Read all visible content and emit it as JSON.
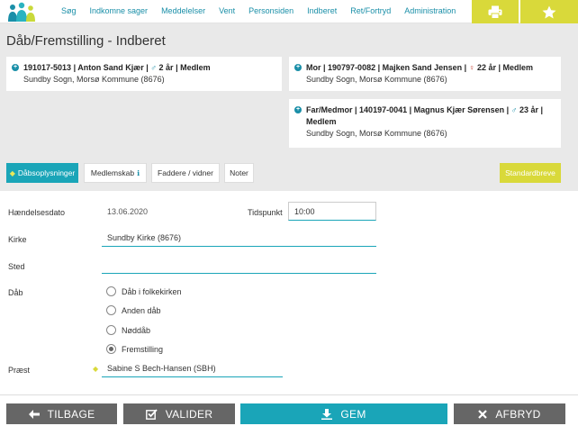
{
  "nav": {
    "items": [
      "Søg",
      "Indkomne sager",
      "Meddelelser",
      "Vent",
      "Personsiden",
      "Indberet",
      "Ret/Fortryd",
      "Administration"
    ],
    "print_icon": "printer-icon",
    "star_icon": "star-icon"
  },
  "page": {
    "title": "Dåb/Fremstilling - Indberet"
  },
  "child": {
    "cpr": "191017-5013",
    "name": "Anton Sand Kjær",
    "age": "2 år",
    "status": "Medlem",
    "location": "Sundby Sogn, Morsø Kommune (8676)"
  },
  "mother": {
    "role": "Mor",
    "cpr": "190797-0082",
    "name": "Majken Sand Jensen",
    "age": "22 år",
    "status": "Medlem",
    "location": "Sundby Sogn, Morsø Kommune (8676)"
  },
  "father": {
    "role": "Far/Medmor",
    "cpr": "140197-0041",
    "name": "Magnus Kjær Sørensen",
    "age": "23 år",
    "status": "Medlem",
    "location": "Sundby Sogn, Morsø Kommune (8676)"
  },
  "tabs": {
    "daab": "Dåbsoplysninger",
    "medlemskab": "Medlemskab",
    "faddere": "Faddere / vidner",
    "noter": "Noter",
    "standardbreve": "Standardbreve"
  },
  "form": {
    "event_date_label": "Hændelsesdato",
    "event_date": "13.06.2020",
    "time_label": "Tidspunkt",
    "time": "10:00",
    "church_label": "Kirke",
    "church": "Sundby Kirke (8676)",
    "place_label": "Sted",
    "place": "",
    "daab_label": "Dåb",
    "daab_options": [
      "Dåb i folkekirken",
      "Anden dåb",
      "Nøddåb",
      "Fremstilling"
    ],
    "daab_selected": "Fremstilling",
    "priest_label": "Præst",
    "priest": "Sabine S Bech-Hansen (SBH)"
  },
  "buttons": {
    "back": "TILBAGE",
    "validate": "VALIDER",
    "save": "GEM",
    "cancel": "AFBRYD"
  }
}
